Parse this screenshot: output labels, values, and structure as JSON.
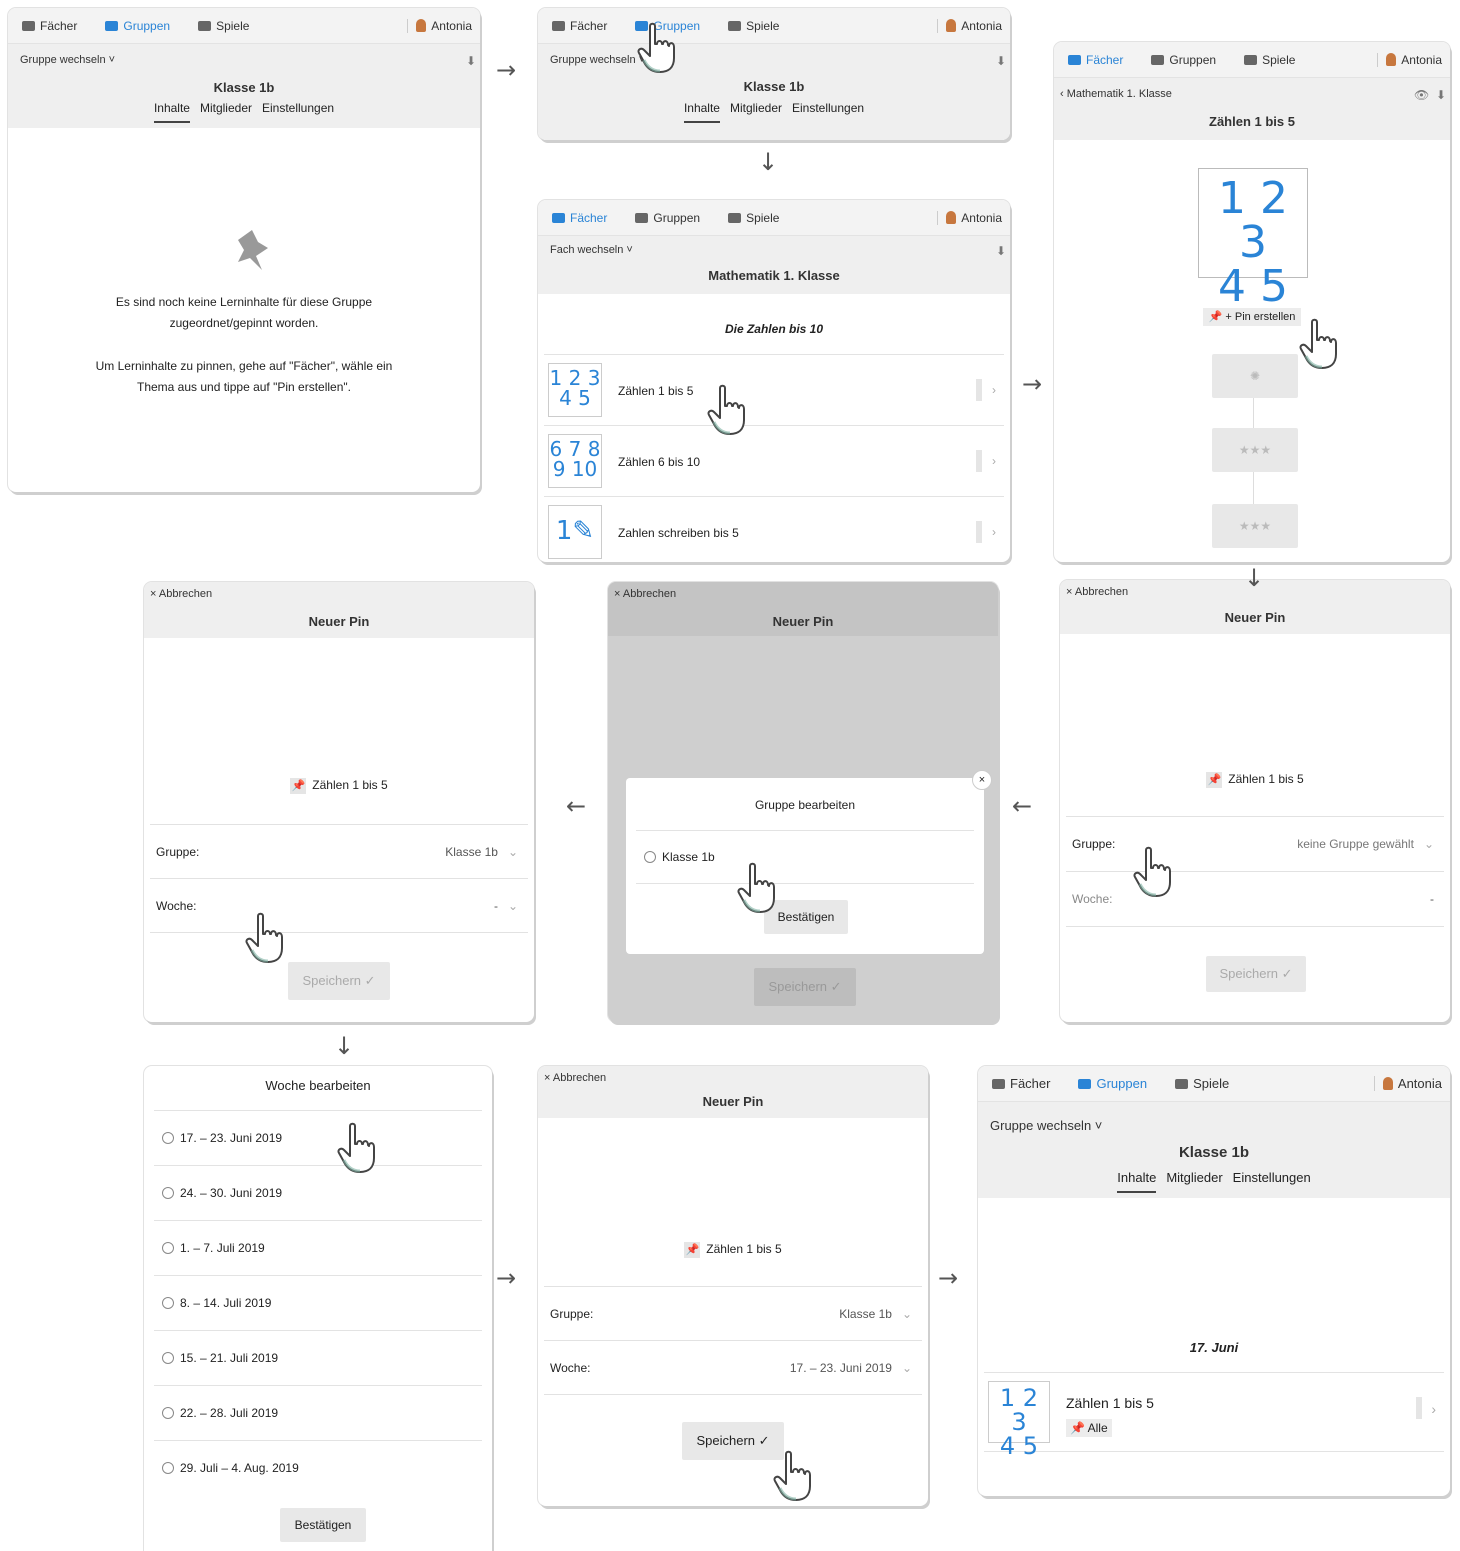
{
  "nav": {
    "faecher": "Fächer",
    "gruppen": "Gruppen",
    "spiele": "Spiele",
    "user": "Antonia"
  },
  "group_page": {
    "switch": "Gruppe wechseln ˅",
    "title": "Klasse 1b",
    "tabs": [
      "Inhalte",
      "Mitglieder",
      "Einstellungen"
    ]
  },
  "empty": {
    "line1": "Es sind noch keine Lerninhalte für diese Gruppe",
    "line2": "zugeordnet/gepinnt worden.",
    "line3": "Um Lerninhalte zu pinnen, gehe auf \"Fächer\", wähle ein",
    "line4": "Thema aus und tippe auf \"Pin erstellen\"."
  },
  "subject": {
    "switch": "Fach wechseln ˅",
    "title": "Mathematik 1. Klasse",
    "section": "Die Zahlen bis 10",
    "items": [
      {
        "label": "Zählen 1 bis 5",
        "thumb1": "1 2 3",
        "thumb2": "4 5"
      },
      {
        "label": "Zählen 6 bis 10",
        "thumb1": "6 7 8",
        "thumb2": "9 10"
      },
      {
        "label": "Zahlen schreiben bis 5",
        "thumb1": "1✎",
        "thumb2": ""
      }
    ]
  },
  "topic": {
    "back": "‹ Mathematik 1. Klasse",
    "title": "Zählen 1 bis 5",
    "big1": "1 2 3",
    "big2": "4 5",
    "pin_btn": "+ Pin erstellen",
    "stars": "★★★"
  },
  "pin": {
    "cancel": "× Abbrechen",
    "title": "Neuer Pin",
    "item": "Zählen 1 bis 5",
    "group_label": "Gruppe:",
    "week_label": "Woche:",
    "no_group": "keine Gruppe gewählt",
    "group_val": "Klasse 1b",
    "dash": "-",
    "save": "Speichern ✓",
    "week_val": "17. – 23. Juni 2019"
  },
  "group_dialog": {
    "title": "Gruppe bearbeiten",
    "option": "Klasse 1b",
    "confirm": "Bestätigen",
    "close": "×"
  },
  "week_dialog": {
    "title": "Woche bearbeiten",
    "weeks": [
      "17. – 23. Juni 2019",
      "24. – 30. Juni 2019",
      "1. – 7. Juli 2019",
      "8. – 14. Juli 2019",
      "15. – 21. Juli 2019",
      "22. – 28. Juli 2019",
      "29. Juli – 4. Aug. 2019"
    ],
    "confirm": "Bestätigen"
  },
  "result": {
    "date": "17. Juni",
    "item": "Zählen 1 bis 5",
    "tag": "Alle"
  },
  "arrows": {
    "right": "→",
    "left": "←",
    "down": "↓"
  }
}
